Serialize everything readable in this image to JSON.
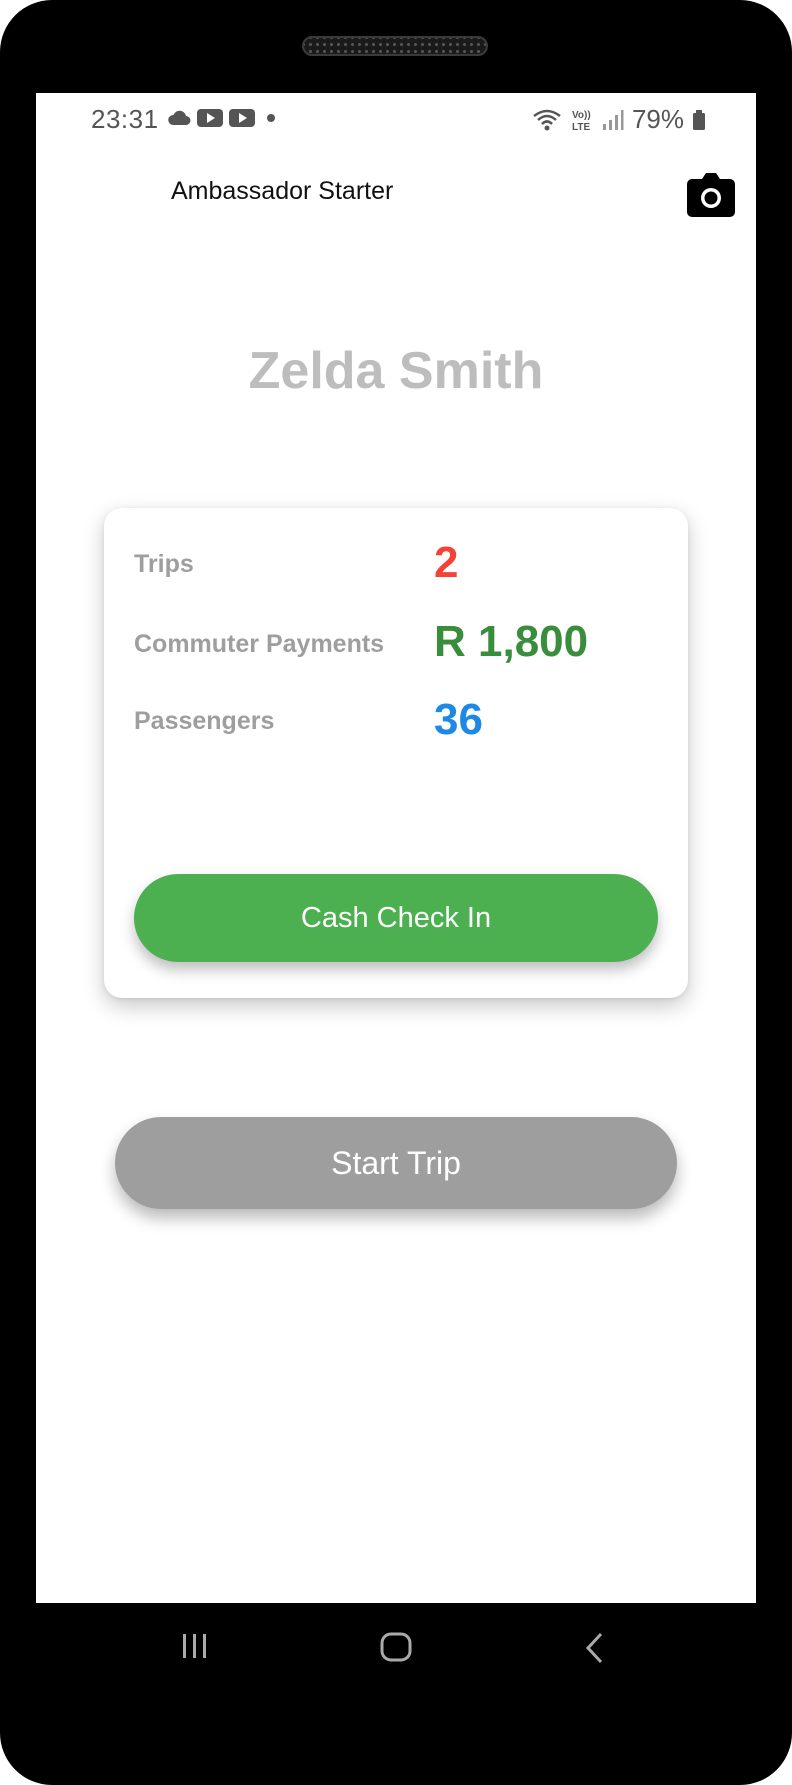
{
  "status_bar": {
    "time": "23:31",
    "battery": "79%",
    "left_icons": [
      "cloud-icon",
      "youtube-icon",
      "youtube-icon",
      "dot-icon"
    ],
    "right_icons": [
      "wifi-icon",
      "volte-icon",
      "signal-icon",
      "battery-icon"
    ]
  },
  "app_bar": {
    "title": "Ambassador Starter",
    "action_icon": "camera-icon"
  },
  "profile": {
    "name": "Zelda Smith"
  },
  "stats": {
    "trips_label": "Trips",
    "trips_value": "2",
    "payments_label": "Commuter Payments",
    "payments_value": "R 1,800",
    "passengers_label": "Passengers",
    "passengers_value": "36"
  },
  "actions": {
    "cash_check_in": "Cash Check In",
    "start_trip": "Start Trip"
  },
  "colors": {
    "trips": "#f44336",
    "payments": "#388e3c",
    "passengers": "#1e88e5",
    "cash_button": "#4caf50",
    "start_button": "#9e9e9e"
  },
  "nav_bar": {
    "icons": [
      "recent-apps-icon",
      "home-icon",
      "back-icon"
    ]
  }
}
